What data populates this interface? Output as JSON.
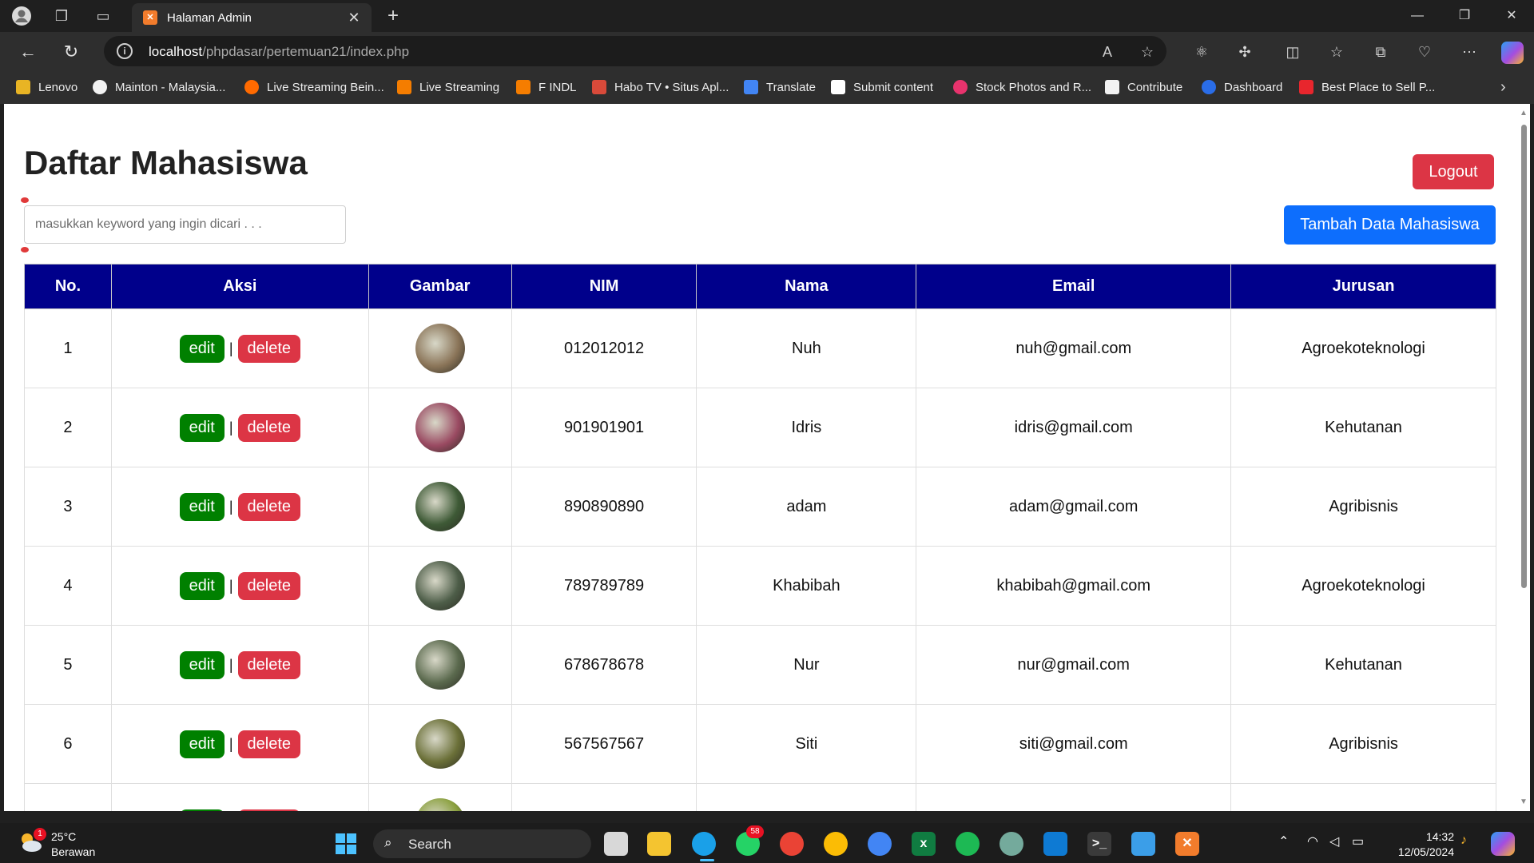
{
  "browser": {
    "tab_title": "Halaman Admin",
    "tab_favicon": "xampp-icon",
    "url_host": "localhost",
    "url_path": "/phpdasar/pertemuan21/index.php",
    "bookmarks": [
      {
        "label": "Lenovo",
        "icon": "folder-icon",
        "color": "#e8b424"
      },
      {
        "label": "Mainton - Malaysia...",
        "icon": "mainton-icon",
        "color": "#f2f2f2"
      },
      {
        "label": "Live Streaming Bein...",
        "icon": "fire-icon",
        "color": "#ff6a00"
      },
      {
        "label": "Live Streaming",
        "icon": "blogger-icon",
        "color": "#f57d00"
      },
      {
        "label": "F INDL",
        "icon": "blogger-icon",
        "color": "#f57d00"
      },
      {
        "label": "Habo TV • Situs Apl...",
        "icon": "habo-icon",
        "color": "#d84a3a"
      },
      {
        "label": "Translate",
        "icon": "translate-icon",
        "color": "#4285f4"
      },
      {
        "label": "Submit content",
        "icon": "submit-icon",
        "color": "#ffffff"
      },
      {
        "label": "Stock Photos and R...",
        "icon": "stock-icon",
        "color": "#e8336d"
      },
      {
        "label": "Contribute",
        "icon": "contribute-icon",
        "color": "#f2f2f2"
      },
      {
        "label": "Dashboard",
        "icon": "dashboard-icon",
        "color": "#2a6de8"
      },
      {
        "label": "Best Place to Sell P...",
        "icon": "adobe-icon",
        "color": "#e8262d"
      }
    ]
  },
  "page": {
    "title": "Daftar Mahasiswa",
    "logout_label": "Logout",
    "add_label": "Tambah Data Mahasiswa",
    "search_placeholder": "masukkan keyword yang ingin dicari . . .",
    "columns": [
      "No.",
      "Aksi",
      "Gambar",
      "NIM",
      "Nama",
      "Email",
      "Jurusan"
    ],
    "edit_label": "edit",
    "delete_label": "delete",
    "separator": "|",
    "rows": [
      {
        "no": "1",
        "nim": "012012012",
        "nama": "Nuh",
        "email": "nuh@gmail.com",
        "jurusan": "Agroekoteknologi",
        "thumb": "#8a7458"
      },
      {
        "no": "2",
        "nim": "901901901",
        "nama": "Idris",
        "email": "idris@gmail.com",
        "jurusan": "Kehutanan",
        "thumb": "#9a4a62"
      },
      {
        "no": "3",
        "nim": "890890890",
        "nama": "adam",
        "email": "adam@gmail.com",
        "jurusan": "Agribisnis",
        "thumb": "#3e5a36"
      },
      {
        "no": "4",
        "nim": "789789789",
        "nama": "Khabibah",
        "email": "khabibah@gmail.com",
        "jurusan": "Agroekoteknologi",
        "thumb": "#4d5d48"
      },
      {
        "no": "5",
        "nim": "678678678",
        "nama": "Nur",
        "email": "nur@gmail.com",
        "jurusan": "Kehutanan",
        "thumb": "#5b6a4e"
      },
      {
        "no": "6",
        "nim": "567567567",
        "nama": "Siti",
        "email": "siti@gmail.com",
        "jurusan": "Agribisnis",
        "thumb": "#6b7038"
      },
      {
        "no": "",
        "nim": "",
        "nama": "",
        "email": "",
        "jurusan": "",
        "thumb": "#8aa03e"
      }
    ]
  },
  "taskbar": {
    "temperature": "25°C",
    "condition": "Berawan",
    "weather_badge": "1",
    "search_label": "Search",
    "whatsapp_badge": "58",
    "time": "14:32",
    "date": "12/05/2024"
  },
  "colors": {
    "table_header": "#00008b",
    "edit": "#008000",
    "delete": "#dc3545",
    "logout": "#dc3545",
    "add": "#0d6efd"
  }
}
